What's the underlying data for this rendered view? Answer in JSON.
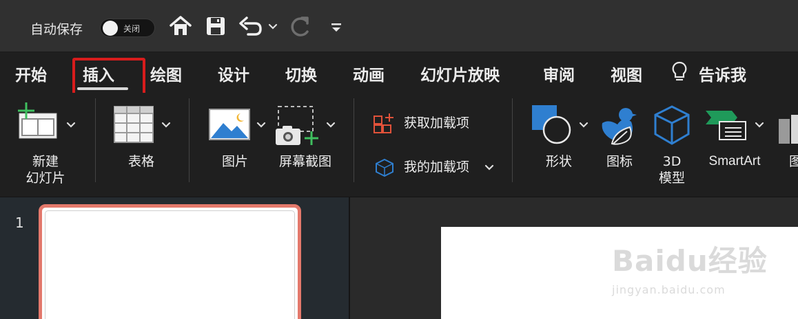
{
  "titlebar": {
    "autosave_label": "自动保存",
    "toggle_label": "关闭"
  },
  "tabs": [
    {
      "label": "开始"
    },
    {
      "label": "插入"
    },
    {
      "label": "绘图"
    },
    {
      "label": "设计"
    },
    {
      "label": "切换"
    },
    {
      "label": "动画"
    },
    {
      "label": "幻灯片放映"
    },
    {
      "label": "审阅"
    },
    {
      "label": "视图"
    },
    {
      "label": "告诉我"
    }
  ],
  "ribbon": {
    "new_slide": [
      "新建",
      "幻灯片"
    ],
    "table": "表格",
    "picture": "图片",
    "screenshot": "屏幕截图",
    "get_addins": "获取加载项",
    "my_addins": "我的加载项",
    "shapes": "形状",
    "icons": "图标",
    "model3d": [
      "3D",
      "模型"
    ],
    "smartart": "SmartArt",
    "chart_partial": "图"
  },
  "slides": {
    "current_number": "1"
  },
  "watermark": {
    "brand": "Baidu经验",
    "site": "jingyan.baidu.com"
  },
  "colors": {
    "accent_highlight": "#d71c1c",
    "thumb_border": "#e4796c",
    "addin_orange": "#e2523a",
    "icon_blue": "#2f7fd0",
    "icon_green": "#3fbf5f"
  }
}
